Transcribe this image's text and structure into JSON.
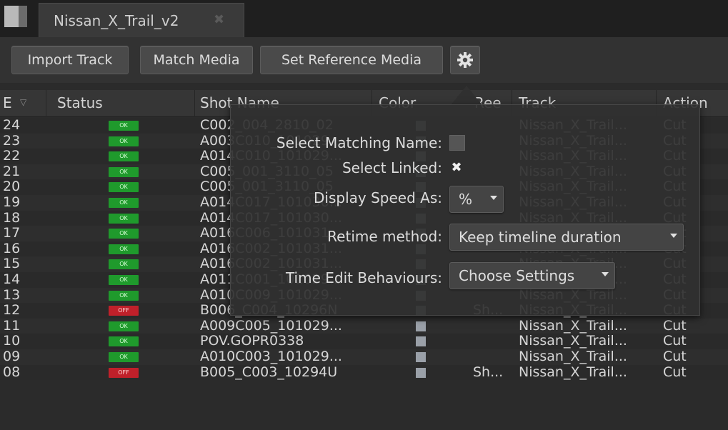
{
  "tab": {
    "title": "Nissan_X_Trail_v2",
    "close_glyph": "✖"
  },
  "toolbar": {
    "import_label": "Import Track",
    "match_label": "Match Media",
    "reference_label": "Set Reference Media",
    "settings_icon": "gear-icon"
  },
  "columns": {
    "event": "E",
    "status": "Status",
    "shot_name": "Shot Name",
    "color": "Color",
    "reel": "Ree",
    "track": "Track",
    "action": "Action"
  },
  "rows": [
    {
      "event": "24",
      "status": "OK",
      "shot": "C002_004_2810_02",
      "reel": "",
      "track": "Nissan_X_Trail...",
      "action": "Cut"
    },
    {
      "event": "23",
      "status": "OK",
      "shot": "A003C010_101029...",
      "reel": "",
      "track": "Nissan_X_Trail...",
      "action": "Cut"
    },
    {
      "event": "22",
      "status": "OK",
      "shot": "A014C010_101029...",
      "reel": "",
      "track": "Nissan_X_Trail...",
      "action": "Cut"
    },
    {
      "event": "21",
      "status": "OK",
      "shot": "C005_001_3110_05",
      "reel": "",
      "track": "Nissan_X_Trail...",
      "action": "Cut"
    },
    {
      "event": "20",
      "status": "OK",
      "shot": "C005_001_3110_05",
      "reel": "",
      "track": "Nissan_X_Trail...",
      "action": "Cut"
    },
    {
      "event": "19",
      "status": "OK",
      "shot": "A014C017_101030...",
      "reel": "",
      "track": "Nissan_X_Trail...",
      "action": "Cut"
    },
    {
      "event": "18",
      "status": "OK",
      "shot": "A014C017_101030...",
      "reel": "",
      "track": "Nissan_X_Trail...",
      "action": "Cut"
    },
    {
      "event": "17",
      "status": "OK",
      "shot": "A016C006_101031...",
      "reel": "",
      "track": "Nissan_X_Trail...",
      "action": "Cut"
    },
    {
      "event": "16",
      "status": "OK",
      "shot": "A016C002_101031...",
      "reel": "",
      "track": "Nissan_X_Trail...",
      "action": "Cut"
    },
    {
      "event": "15",
      "status": "OK",
      "shot": "A016C002_101031...",
      "reel": "",
      "track": "Nissan_X_Trail...",
      "action": "Cut"
    },
    {
      "event": "14",
      "status": "OK",
      "shot": "A011C001_101029...",
      "reel": "",
      "track": "Nissan_X_Trail...",
      "action": "Cut"
    },
    {
      "event": "13",
      "status": "OK",
      "shot": "A010C009_101029...",
      "reel": "",
      "track": "Nissan_X_Trail...",
      "action": "Cut"
    },
    {
      "event": "12",
      "status": "OFF",
      "shot": "B006_C004_10296N",
      "reel": "Sh...",
      "track": "Nissan_X_Trail...",
      "action": "Cut"
    },
    {
      "event": "11",
      "status": "OK",
      "shot": "A009C005_101029...",
      "reel": "",
      "track": "Nissan_X_Trail...",
      "action": "Cut"
    },
    {
      "event": "10",
      "status": "OK",
      "shot": "POV.GOPR0338",
      "reel": "",
      "track": "Nissan_X_Trail...",
      "action": "Cut"
    },
    {
      "event": "09",
      "status": "OK",
      "shot": "A010C003_101029...",
      "reel": "",
      "track": "Nissan_X_Trail...",
      "action": "Cut"
    },
    {
      "event": "08",
      "status": "OFF",
      "shot": "B005_C003_10294U",
      "reel": "Sh...",
      "track": "Nissan_X_Trail...",
      "action": "Cut"
    }
  ],
  "status_colors": {
    "OK": "#1f9a2c",
    "OFF": "#c0202a"
  },
  "popup": {
    "select_matching_label": "Select Matching Name:",
    "select_matching_checked": false,
    "select_linked_label": "Select Linked:",
    "select_linked_checked": true,
    "linked_glyph": "✖",
    "display_speed_label": "Display Speed As:",
    "display_speed_value": "%",
    "retime_label": "Retime method:",
    "retime_value": "Keep timeline duration",
    "time_edit_label": "Time Edit Behaviours:",
    "time_edit_value": "Choose Settings"
  }
}
